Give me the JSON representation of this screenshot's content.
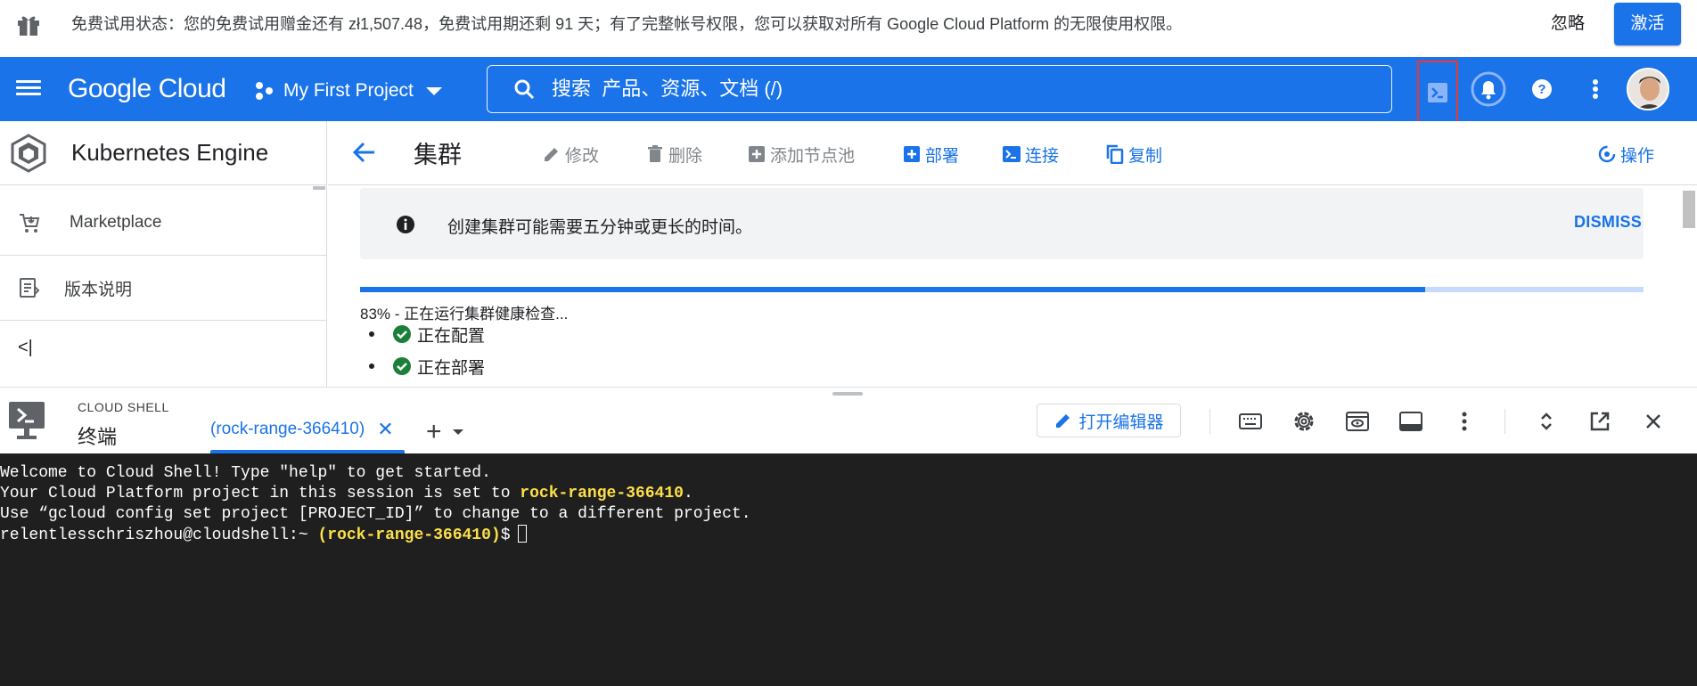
{
  "banner": {
    "message": "免费试用状态：您的免费试用赠金还有 zł1,507.48，免费试用期还剩 91 天；有了完整帐号权限，您可以获取对所有 Google Cloud Platform 的无限使用权限。",
    "ignore_label": "忽略",
    "activate_label": "激活"
  },
  "header": {
    "logo": "Google Cloud",
    "project_name": "My First Project",
    "search_placeholder": "搜索  产品、资源、文档 (/)",
    "icons": [
      "cloud-shell-icon",
      "notifications-icon",
      "help-icon",
      "more-vert-icon",
      "avatar"
    ]
  },
  "sidebar": {
    "product_title": "Kubernetes Engine",
    "items": [
      {
        "label": "Marketplace",
        "icon": "cart-icon"
      },
      {
        "label": "版本说明",
        "icon": "release-notes-icon"
      }
    ],
    "collapse_label": "<|"
  },
  "toolbar": {
    "title": "集群",
    "actions": [
      {
        "label": "修改",
        "enabled": false
      },
      {
        "label": "删除",
        "enabled": false
      },
      {
        "label": "添加节点池",
        "enabled": false
      },
      {
        "label": "部署",
        "enabled": true
      },
      {
        "label": "连接",
        "enabled": true
      },
      {
        "label": "复制",
        "enabled": true
      }
    ],
    "operations_label": "操作"
  },
  "main": {
    "notice_text": "创建集群可能需要五分钟或更长的时间。",
    "dismiss_label": "DISMISS",
    "progress_percent": 83,
    "progress_text": "83% - 正在运行集群健康检查...",
    "steps": [
      {
        "label": "正在配置",
        "done": true
      },
      {
        "label": "正在部署",
        "done": true
      }
    ]
  },
  "shell": {
    "label": "CLOUD SHELL",
    "title": "终端",
    "tab_label": "(rock-range-366410)",
    "tab_close": "✕",
    "add_tab": "+",
    "editor_label": "打开编辑器",
    "terminal": {
      "line1": "Welcome to Cloud Shell! Type \"help\" to get started.",
      "line2_prefix": "Your Cloud Platform project in this session is set to ",
      "line2_project": "rock-range-366410",
      "line2_suffix": ".",
      "line3": "Use “gcloud config set project [PROJECT_ID]” to change to a different project.",
      "prompt_user": "relentlesschriszhou@cloudshell:~ ",
      "prompt_project": "(rock-range-366410)",
      "prompt_suffix": "$"
    }
  },
  "colors": {
    "brand_blue": "#1a73e8",
    "terminal_bg": "#1f1f1f",
    "highlight": "#fde047",
    "success_green": "#188038",
    "focus_red": "#e53935"
  }
}
